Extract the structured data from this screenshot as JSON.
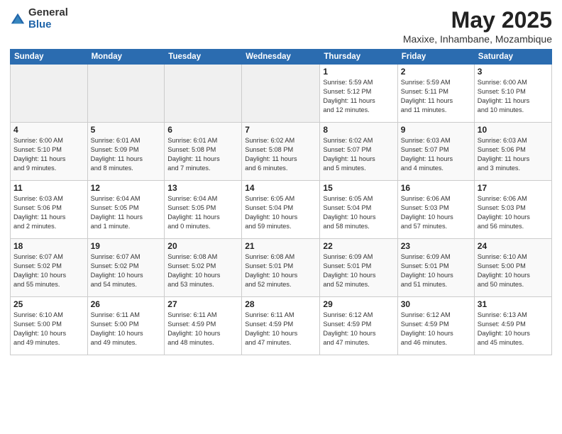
{
  "header": {
    "logo_general": "General",
    "logo_blue": "Blue",
    "title": "May 2025",
    "location": "Maxixe, Inhambane, Mozambique"
  },
  "weekdays": [
    "Sunday",
    "Monday",
    "Tuesday",
    "Wednesday",
    "Thursday",
    "Friday",
    "Saturday"
  ],
  "weeks": [
    [
      {
        "day": "",
        "info": ""
      },
      {
        "day": "",
        "info": ""
      },
      {
        "day": "",
        "info": ""
      },
      {
        "day": "",
        "info": ""
      },
      {
        "day": "1",
        "info": "Sunrise: 5:59 AM\nSunset: 5:12 PM\nDaylight: 11 hours\nand 12 minutes."
      },
      {
        "day": "2",
        "info": "Sunrise: 5:59 AM\nSunset: 5:11 PM\nDaylight: 11 hours\nand 11 minutes."
      },
      {
        "day": "3",
        "info": "Sunrise: 6:00 AM\nSunset: 5:10 PM\nDaylight: 11 hours\nand 10 minutes."
      }
    ],
    [
      {
        "day": "4",
        "info": "Sunrise: 6:00 AM\nSunset: 5:10 PM\nDaylight: 11 hours\nand 9 minutes."
      },
      {
        "day": "5",
        "info": "Sunrise: 6:01 AM\nSunset: 5:09 PM\nDaylight: 11 hours\nand 8 minutes."
      },
      {
        "day": "6",
        "info": "Sunrise: 6:01 AM\nSunset: 5:08 PM\nDaylight: 11 hours\nand 7 minutes."
      },
      {
        "day": "7",
        "info": "Sunrise: 6:02 AM\nSunset: 5:08 PM\nDaylight: 11 hours\nand 6 minutes."
      },
      {
        "day": "8",
        "info": "Sunrise: 6:02 AM\nSunset: 5:07 PM\nDaylight: 11 hours\nand 5 minutes."
      },
      {
        "day": "9",
        "info": "Sunrise: 6:03 AM\nSunset: 5:07 PM\nDaylight: 11 hours\nand 4 minutes."
      },
      {
        "day": "10",
        "info": "Sunrise: 6:03 AM\nSunset: 5:06 PM\nDaylight: 11 hours\nand 3 minutes."
      }
    ],
    [
      {
        "day": "11",
        "info": "Sunrise: 6:03 AM\nSunset: 5:06 PM\nDaylight: 11 hours\nand 2 minutes."
      },
      {
        "day": "12",
        "info": "Sunrise: 6:04 AM\nSunset: 5:05 PM\nDaylight: 11 hours\nand 1 minute."
      },
      {
        "day": "13",
        "info": "Sunrise: 6:04 AM\nSunset: 5:05 PM\nDaylight: 11 hours\nand 0 minutes."
      },
      {
        "day": "14",
        "info": "Sunrise: 6:05 AM\nSunset: 5:04 PM\nDaylight: 10 hours\nand 59 minutes."
      },
      {
        "day": "15",
        "info": "Sunrise: 6:05 AM\nSunset: 5:04 PM\nDaylight: 10 hours\nand 58 minutes."
      },
      {
        "day": "16",
        "info": "Sunrise: 6:06 AM\nSunset: 5:03 PM\nDaylight: 10 hours\nand 57 minutes."
      },
      {
        "day": "17",
        "info": "Sunrise: 6:06 AM\nSunset: 5:03 PM\nDaylight: 10 hours\nand 56 minutes."
      }
    ],
    [
      {
        "day": "18",
        "info": "Sunrise: 6:07 AM\nSunset: 5:02 PM\nDaylight: 10 hours\nand 55 minutes."
      },
      {
        "day": "19",
        "info": "Sunrise: 6:07 AM\nSunset: 5:02 PM\nDaylight: 10 hours\nand 54 minutes."
      },
      {
        "day": "20",
        "info": "Sunrise: 6:08 AM\nSunset: 5:02 PM\nDaylight: 10 hours\nand 53 minutes."
      },
      {
        "day": "21",
        "info": "Sunrise: 6:08 AM\nSunset: 5:01 PM\nDaylight: 10 hours\nand 52 minutes."
      },
      {
        "day": "22",
        "info": "Sunrise: 6:09 AM\nSunset: 5:01 PM\nDaylight: 10 hours\nand 52 minutes."
      },
      {
        "day": "23",
        "info": "Sunrise: 6:09 AM\nSunset: 5:01 PM\nDaylight: 10 hours\nand 51 minutes."
      },
      {
        "day": "24",
        "info": "Sunrise: 6:10 AM\nSunset: 5:00 PM\nDaylight: 10 hours\nand 50 minutes."
      }
    ],
    [
      {
        "day": "25",
        "info": "Sunrise: 6:10 AM\nSunset: 5:00 PM\nDaylight: 10 hours\nand 49 minutes."
      },
      {
        "day": "26",
        "info": "Sunrise: 6:11 AM\nSunset: 5:00 PM\nDaylight: 10 hours\nand 49 minutes."
      },
      {
        "day": "27",
        "info": "Sunrise: 6:11 AM\nSunset: 4:59 PM\nDaylight: 10 hours\nand 48 minutes."
      },
      {
        "day": "28",
        "info": "Sunrise: 6:11 AM\nSunset: 4:59 PM\nDaylight: 10 hours\nand 47 minutes."
      },
      {
        "day": "29",
        "info": "Sunrise: 6:12 AM\nSunset: 4:59 PM\nDaylight: 10 hours\nand 47 minutes."
      },
      {
        "day": "30",
        "info": "Sunrise: 6:12 AM\nSunset: 4:59 PM\nDaylight: 10 hours\nand 46 minutes."
      },
      {
        "day": "31",
        "info": "Sunrise: 6:13 AM\nSunset: 4:59 PM\nDaylight: 10 hours\nand 45 minutes."
      }
    ]
  ]
}
